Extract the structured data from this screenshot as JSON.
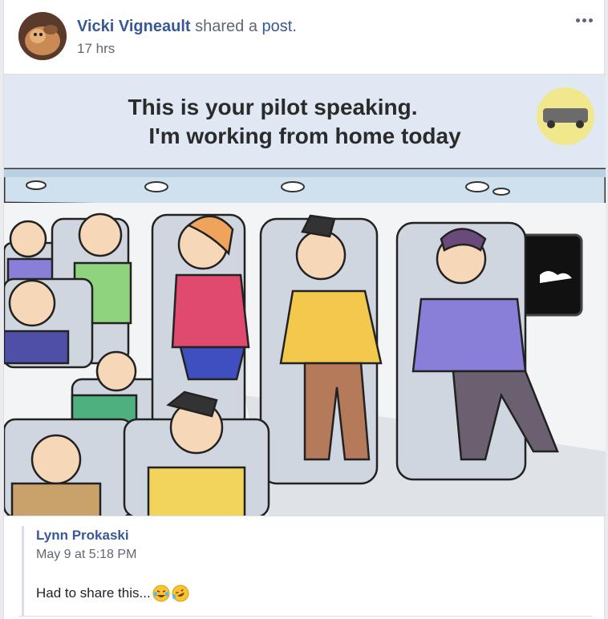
{
  "post": {
    "actor_name": "Vicki Vigneault",
    "action_text": "shared a",
    "action_link": "post.",
    "timestamp": "17 hrs",
    "more_icon": "ellipsis-icon"
  },
  "image": {
    "caption_line1": "This is your pilot speaking.",
    "caption_line2": "I'm working from home today",
    "colors": {
      "sky": "#dfe8f3",
      "ceiling": "#cfe0ee",
      "seat": "#cfd6df",
      "shirt_green": "#8fd37f",
      "shirt_red": "#e04a6e",
      "shirt_yellow": "#f2c94c",
      "shirt_purple": "#8a7fd8"
    }
  },
  "shared_post": {
    "author": "Lynn Prokaski",
    "date": "May 9 at 5:18 PM",
    "message": "Had to share this...",
    "emojis": [
      "tears-of-joy-emoji",
      "rofl-emoji"
    ]
  }
}
